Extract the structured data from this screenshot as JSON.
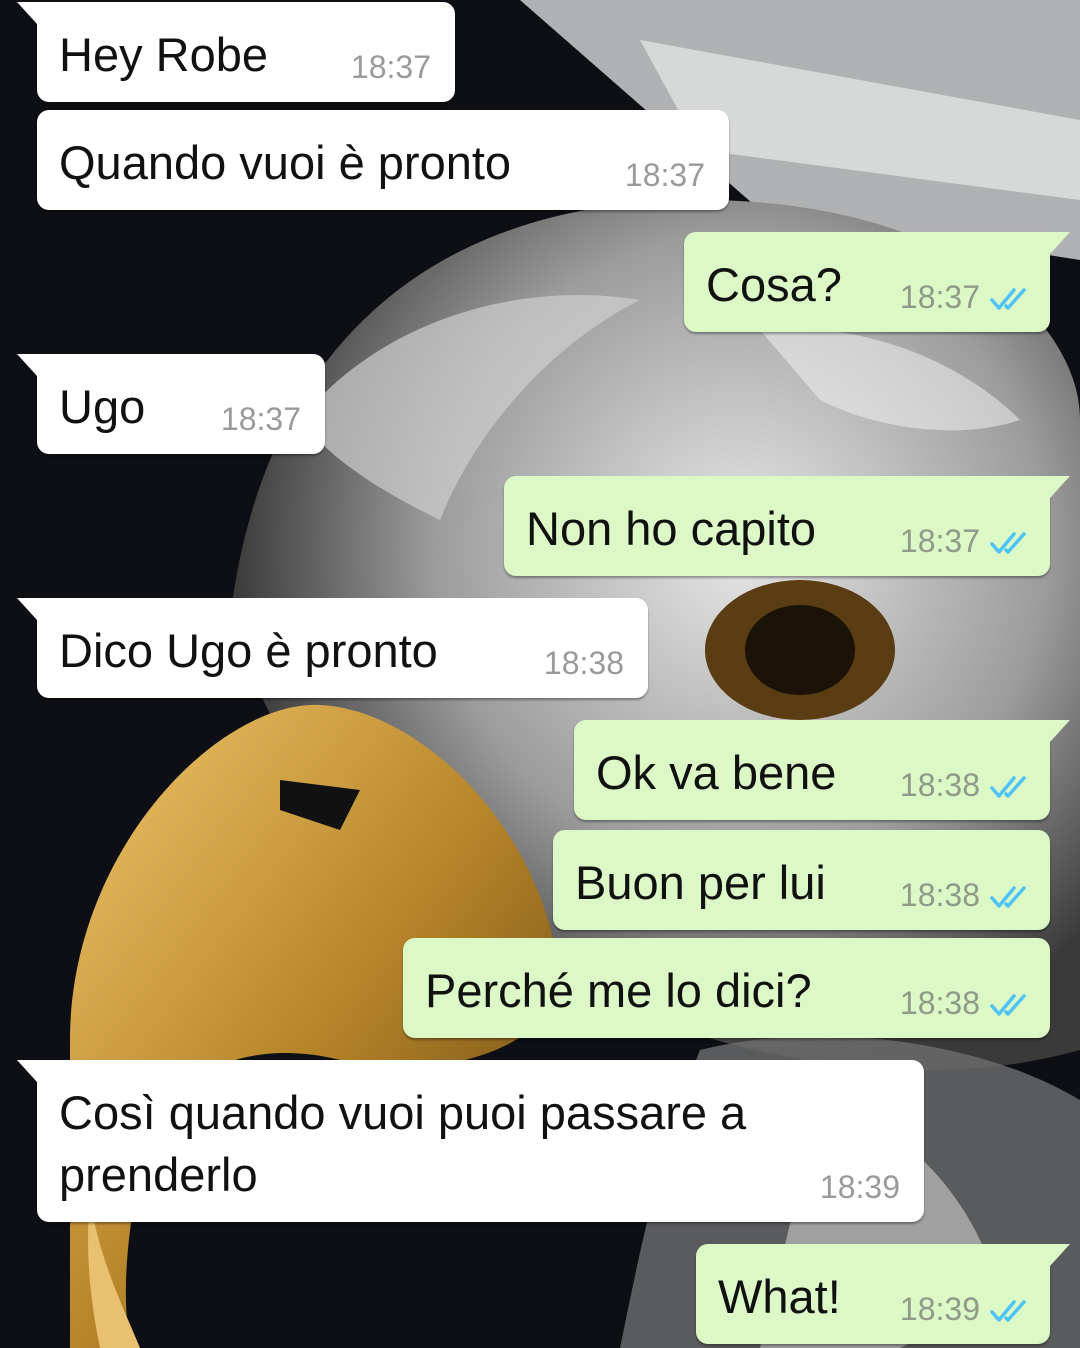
{
  "colors": {
    "incoming_bubble": "#ffffff",
    "outgoing_bubble": "#dcf8c6",
    "read_ticks": "#4fc3f7",
    "timestamp": "#9a9a9a"
  },
  "wallpaper": {
    "icon": "eagle-wallpaper"
  },
  "messages": [
    {
      "direction": "in",
      "text": "Hey Robe",
      "time": "18:37"
    },
    {
      "direction": "in",
      "text": "Quando vuoi è pronto",
      "time": "18:37"
    },
    {
      "direction": "out",
      "text": "Cosa?",
      "time": "18:37",
      "status": "read"
    },
    {
      "direction": "in",
      "text": "Ugo",
      "time": "18:37"
    },
    {
      "direction": "out",
      "text": "Non ho capito",
      "time": "18:37",
      "status": "read"
    },
    {
      "direction": "in",
      "text": "Dico Ugo è pronto",
      "time": "18:38"
    },
    {
      "direction": "out",
      "text": "Ok va bene",
      "time": "18:38",
      "status": "read"
    },
    {
      "direction": "out",
      "text": "Buon per lui",
      "time": "18:38",
      "status": "read"
    },
    {
      "direction": "out",
      "text": "Perché me lo dici?",
      "time": "18:38",
      "status": "read"
    },
    {
      "direction": "in",
      "text": "Così quando vuoi puoi passare a\nprenderlo",
      "time": "18:39"
    },
    {
      "direction": "out",
      "text": "What!",
      "time": "18:39",
      "status": "read"
    }
  ]
}
